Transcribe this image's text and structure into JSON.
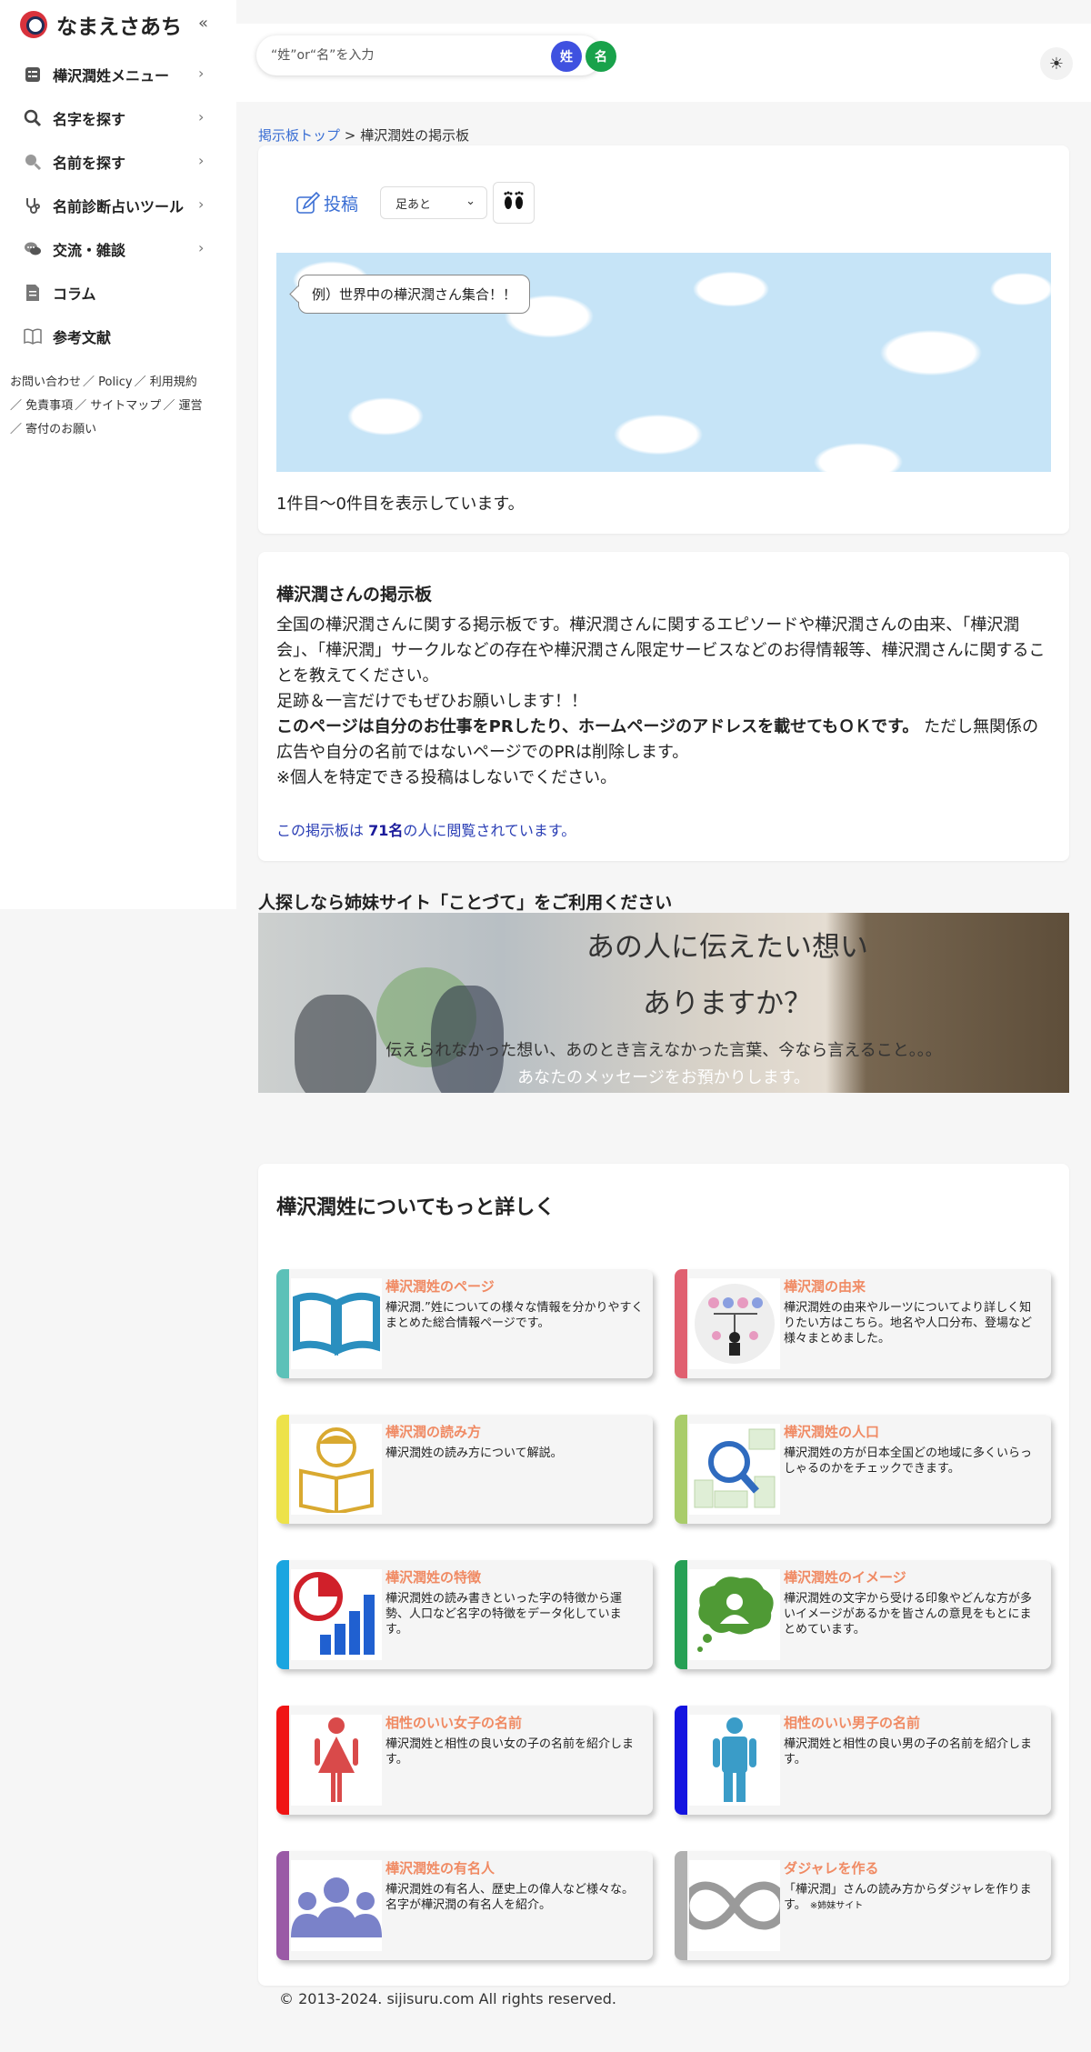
{
  "sidebar": {
    "logo_text": "なまえさあち",
    "collapse_icon": "«",
    "items": [
      {
        "label": "樺沢潤姓メニュー",
        "icon": "list-icon",
        "chevron": true
      },
      {
        "label": "名字を探す",
        "icon": "search-icon",
        "chevron": true
      },
      {
        "label": "名前を探す",
        "icon": "search-icon",
        "chevron": true
      },
      {
        "label": "名前診断占いツール",
        "icon": "stethoscope-icon",
        "chevron": true
      },
      {
        "label": "交流・雑談",
        "icon": "chat-icon",
        "chevron": true
      },
      {
        "label": "コラム",
        "icon": "document-icon",
        "chevron": false
      },
      {
        "label": "参考文献",
        "icon": "book-icon",
        "chevron": false
      }
    ],
    "links": [
      "お問い合わせ",
      "Policy",
      "利用規約",
      "免責事項",
      "サイトマップ",
      "運営",
      "寄付のお願い"
    ]
  },
  "search": {
    "placeholder": "“姓”or“名”を入力",
    "sei_label": "姓",
    "mei_label": "名",
    "sei_color": "#3f51e0",
    "mei_color": "#19a24b"
  },
  "breadcrumb": {
    "home": "掲示板トップ",
    "separator": " > ",
    "current": "樺沢潤姓の掲示板"
  },
  "board": {
    "post_label": "投稿",
    "sort_value": "足あと",
    "bubble_text": "例）世界中の樺沢潤さん集合！！",
    "count_text": "1件目〜0件目を表示しています。"
  },
  "info": {
    "title": "樺沢潤さんの掲示板",
    "para1": "全国の樺沢潤さんに関する掲示板です。樺沢潤さんに関するエピソードや樺沢潤さんの由来、「樺沢潤会」、「樺沢潤」サークルなどの存在や樺沢潤さん限定サービスなどのお得情報等、樺沢潤さんに関することを教えてください。",
    "para2": "足跡＆一言だけでもぜひお願いします！！",
    "para3_bold": "このページは自分のお仕事をPRしたり、ホームページのアドレスを載せてもＯＫです。",
    "para3_rest": " ただし無関係の広告や自分の名前ではないページでのPRは削除します。",
    "para4": "※個人を特定できる投稿はしないでください。",
    "views_prefix": "この掲示板は ",
    "views_count": "71名",
    "views_suffix": "の人に閲覧されています。"
  },
  "kotozute": {
    "title": "人探しなら姉妹サイト「ことづて」をご利用ください",
    "line1": "あの人に伝えたい想い",
    "line2": "ありますか？",
    "line3": "伝えられなかった想い、あのとき言えなかった言葉、今なら言えること。。。",
    "line4": "あなたのメッセージをお預かりします。"
  },
  "more": {
    "title": "樺沢潤姓についてもっと詳しく",
    "tiles": [
      {
        "title": "樺沢潤姓のページ",
        "desc": "樺沢潤.”姓についての様々な情報を分かりやすくまとめた総合情報ページです。",
        "bar_color": "#5cc1b8",
        "icon": "open-book-icon"
      },
      {
        "title": "樺沢潤の由来",
        "desc": "樺沢潤姓の由来やルーツについてより詳しく知りたい方はこちら。地名や人口分布、登場など様々まとめました。",
        "bar_color": "#e06070",
        "icon": "family-tree-icon"
      },
      {
        "title": "樺沢潤の読み方",
        "desc": "樺沢潤姓の読み方について解説。",
        "bar_color": "#ede24a",
        "icon": "reading-person-icon"
      },
      {
        "title": "樺沢潤姓の人口",
        "desc": "樺沢潤姓の方が日本全国どの地域に多くいらっしゃるのかをチェックできます。",
        "bar_color": "#a9cc6a",
        "icon": "map-magnifier-icon"
      },
      {
        "title": "樺沢潤姓の特徴",
        "desc": "樺沢潤姓の読み書きといった字の特徴から運勢、人口など名字の特徴をデータ化しています。",
        "bar_color": "#1aa5e0",
        "icon": "chart-icon"
      },
      {
        "title": "樺沢潤姓のイメージ",
        "desc": "樺沢潤姓の文字から受ける印象やどんな方が多いイメージがあるかを皆さんの意見をもとにまとめています。",
        "bar_color": "#27a055",
        "icon": "thought-bubble-icon"
      },
      {
        "title": "相性のいい女子の名前",
        "desc": "樺沢潤姓と相性の良い女の子の名前を紹介します。",
        "bar_color": "#f01414",
        "icon": "female-icon"
      },
      {
        "title": "相性のいい男子の名前",
        "desc": "樺沢潤姓と相性の良い男の子の名前を紹介します。",
        "bar_color": "#1414e0",
        "icon": "male-icon"
      },
      {
        "title": "樺沢潤姓の有名人",
        "desc": "樺沢潤姓の有名人、歴史上の偉人など様々な。名字が樺沢潤の有名人を紹介。",
        "bar_color": "#9a5aa6",
        "icon": "group-icon"
      },
      {
        "title": "ダジャレを作る",
        "desc": "「樺沢潤」さんの読み方からダジャレを作ります。",
        "desc_small": "※姉妹サイト",
        "bar_color": "#b0b0b0",
        "icon": "infinity-icon"
      }
    ]
  },
  "footer": {
    "copyright": "© 2013-2024. sijisuru.com All rights reserved."
  }
}
